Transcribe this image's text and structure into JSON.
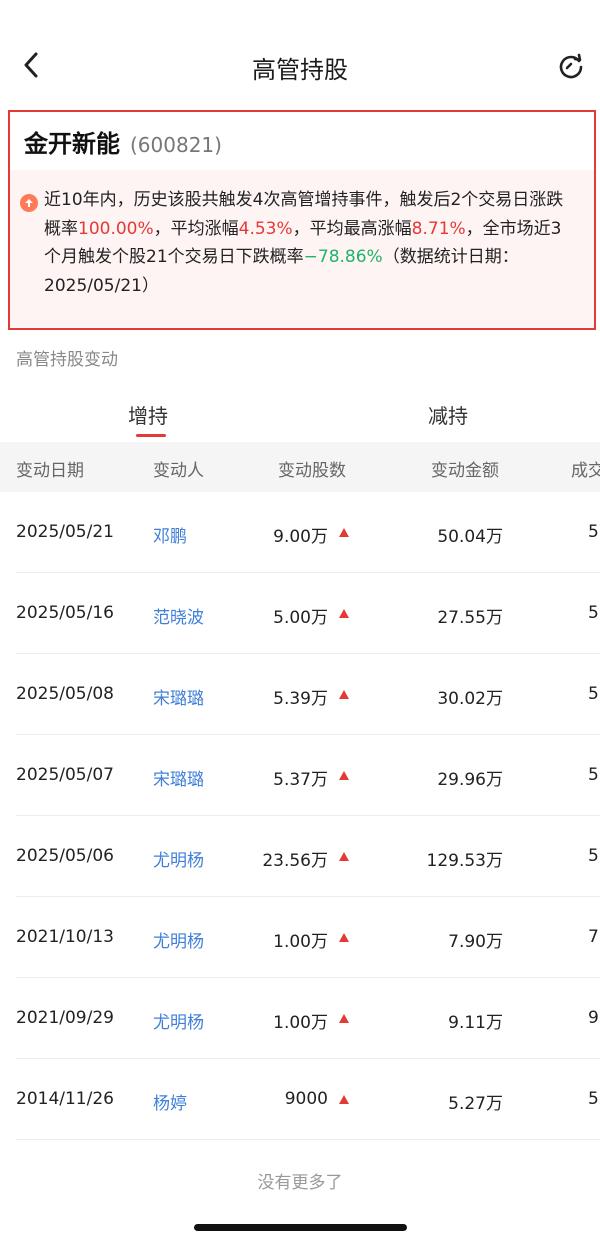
{
  "header": {
    "title": "高管持股"
  },
  "stock": {
    "name": "金开新能",
    "code": "(600821)",
    "desc_p1": "近10年内，历史该股共触发4次高管增持事件，触发后2个交易日涨跌概率",
    "rise_prob": "100.00%",
    "desc_p2": "，平均涨幅",
    "avg_gain": "4.53%",
    "desc_p3": "，平均最高涨幅",
    "avg_max_gain": "8.71%",
    "desc_p4": "，全市场近3个月触发个股21个交易日下跌概率",
    "fall_prob": "−78.86%",
    "desc_p5": "（数据统计日期：2025/05/21）"
  },
  "section_label": "高管持股变动",
  "tabs": [
    {
      "label": "增持"
    },
    {
      "label": "减持"
    }
  ],
  "table": {
    "columns": [
      "变动日期",
      "变动人",
      "变动股数",
      "变动金额",
      "成交"
    ],
    "rows": [
      {
        "date": "2025/05/21",
        "person": "邓鹏",
        "shares": "9.00万",
        "amount": "50.04万",
        "extra": "5"
      },
      {
        "date": "2025/05/16",
        "person": "范晓波",
        "shares": "5.00万",
        "amount": "27.55万",
        "extra": "5"
      },
      {
        "date": "2025/05/08",
        "person": "宋璐璐",
        "shares": "5.39万",
        "amount": "30.02万",
        "extra": "5"
      },
      {
        "date": "2025/05/07",
        "person": "宋璐璐",
        "shares": "5.37万",
        "amount": "29.96万",
        "extra": "5"
      },
      {
        "date": "2025/05/06",
        "person": "尤明杨",
        "shares": "23.56万",
        "amount": "129.53万",
        "extra": "5"
      },
      {
        "date": "2021/10/13",
        "person": "尤明杨",
        "shares": "1.00万",
        "amount": "7.90万",
        "extra": "7"
      },
      {
        "date": "2021/09/29",
        "person": "尤明杨",
        "shares": "1.00万",
        "amount": "9.11万",
        "extra": "9"
      },
      {
        "date": "2014/11/26",
        "person": "杨婷",
        "shares": "9000",
        "amount": "5.27万",
        "extra": "5"
      }
    ]
  },
  "footer_note": "没有更多了",
  "colors": {
    "accent": "#e53935",
    "link": "#3f7fd9",
    "down": "#1fb46a"
  }
}
